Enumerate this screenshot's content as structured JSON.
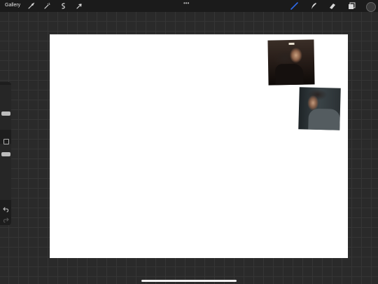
{
  "topbar": {
    "gallery_label": "Gallery",
    "more_label": "•••",
    "left_tools": [
      "wrench-icon",
      "magic-wand-icon",
      "selection-icon",
      "transform-icon"
    ],
    "right_tools": [
      "brush-icon",
      "smudge-icon",
      "eraser-icon",
      "layers-icon"
    ],
    "active_tool": "brush-icon",
    "accent_color": "#2f6ae8",
    "current_color": "#3a3a3a"
  },
  "canvas": {
    "background": "#ffffff",
    "photos": [
      "photo-1",
      "photo-2"
    ]
  },
  "sidebar": {
    "brush_size_level": 0.45,
    "opacity_level": 0.55,
    "buttons": [
      "modify-button",
      "undo-icon",
      "redo-icon"
    ]
  }
}
